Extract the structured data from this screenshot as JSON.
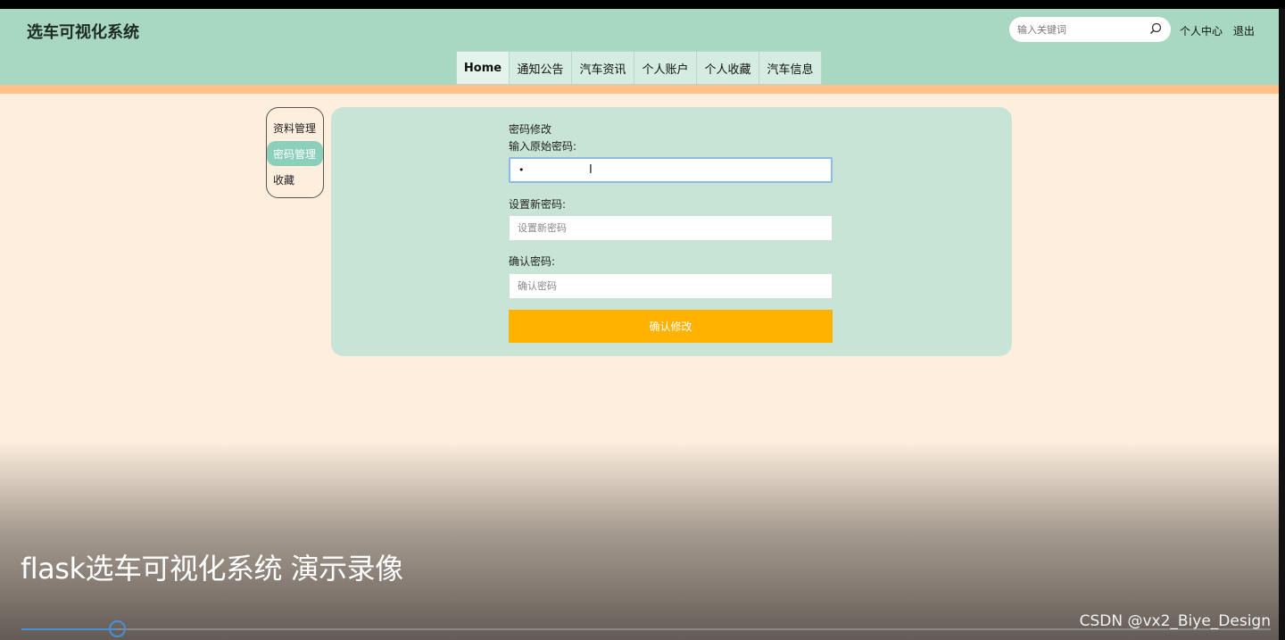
{
  "brand": "选车可视化系统",
  "search": {
    "placeholder": "输入关键词"
  },
  "user_links": [
    "个人中心",
    "退出"
  ],
  "nav": [
    "Home",
    "通知公告",
    "汽车资讯",
    "个人账户",
    "个人收藏",
    "汽车信息"
  ],
  "side_menu": [
    "资料管理",
    "密码管理",
    "收藏"
  ],
  "form": {
    "title": "密码修改",
    "old_label": "输入原始密码:",
    "old_value": "•",
    "new_label": "设置新密码:",
    "new_placeholder": "设置新密码",
    "confirm_label": "确认密码:",
    "confirm_placeholder": "确认密码",
    "submit_label": "确认修改"
  },
  "video": {
    "title": "flask选车可视化系统 演示录像",
    "progress": 0.077
  },
  "watermark": "CSDN @vx2_Biye_Design",
  "colors": {
    "header": "#a8d8c2",
    "accent_bar": "#ffc08a",
    "panel": "#c7e4d7",
    "button": "#ffb300",
    "background": "#fdeedd"
  },
  "icons": {
    "search": "search-icon",
    "progress_knob": "progress-knob-icon"
  }
}
